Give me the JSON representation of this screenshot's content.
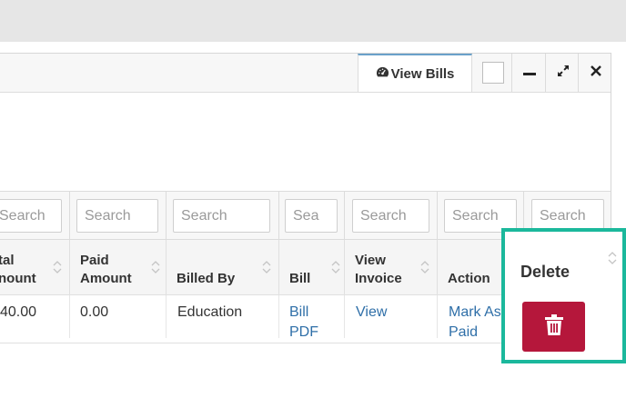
{
  "panel": {
    "tab_label": "View Bills",
    "tab_icon": "dashboard-icon",
    "controls": [
      "minimize-icon",
      "expand-icon",
      "close-icon"
    ]
  },
  "search_placeholders": [
    "Search",
    "Search",
    "Search",
    "Sea",
    "Search",
    "Search",
    "Search"
  ],
  "columns": {
    "total_amount": [
      "tal",
      "nount"
    ],
    "paid_amount": [
      "Paid",
      "Amount"
    ],
    "billed_by": "Billed By",
    "bill": "Bill",
    "view_invoice": [
      "View",
      "Invoice"
    ],
    "action": "Action",
    "delete": "Delete"
  },
  "row": {
    "total_amount": "40.00",
    "paid_amount": "0.00",
    "billed_by": "Education",
    "bill_link": [
      "Bill",
      "PDF"
    ],
    "view_link": "View",
    "action_link": [
      "Mark As",
      "Paid"
    ],
    "delete_icon": "trash-icon"
  },
  "colors": {
    "accent_link": "#2f6fa8",
    "delete_button": "#b5173b",
    "highlight_border": "#1bb89c",
    "tab_top_border": "#6aa1c9"
  }
}
